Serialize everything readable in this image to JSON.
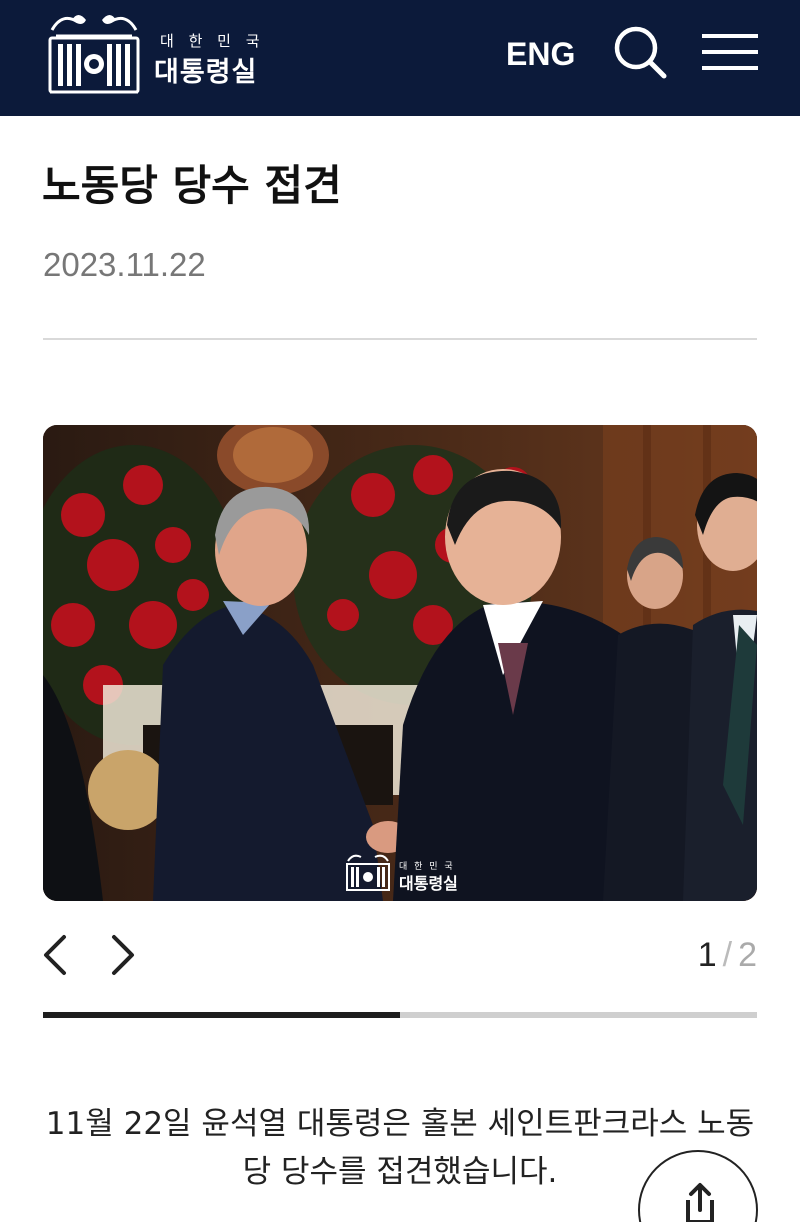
{
  "header": {
    "logo_small_text": "대 한 민 국",
    "logo_main_text": "대통령실",
    "lang_label": "ENG",
    "search_icon": "search-icon",
    "menu_icon": "menu-icon",
    "background_color": "#0c1a3a"
  },
  "article": {
    "title": "노동당 당수 접견",
    "date": "2023.11.22"
  },
  "gallery": {
    "photo": "handshake-photo",
    "watermark_small": "대 한 민 국",
    "watermark_main": "대통령실",
    "current": "1",
    "separator": "/",
    "total": "2",
    "progress": 0.5
  },
  "caption": "11월 22일 윤석열 대통령은 홀본 세인트판크라스 노동당 당수를 접견했습니다.",
  "share_icon": "share-icon"
}
